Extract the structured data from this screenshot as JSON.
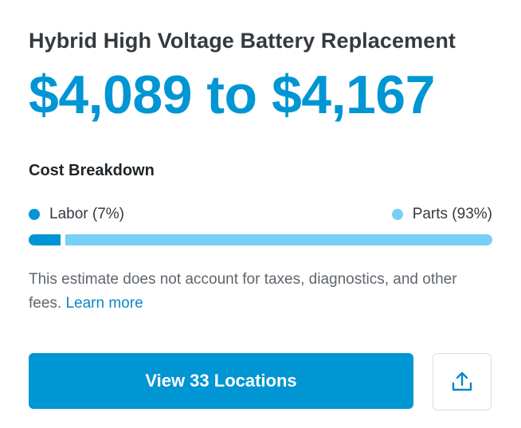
{
  "title": "Hybrid High Voltage Battery Replacement",
  "price_range": "$4,089 to $4,167",
  "breakdown": {
    "heading": "Cost Breakdown",
    "labor": {
      "label": "Labor (7%)",
      "percent": 7,
      "color": "#0095d3"
    },
    "parts": {
      "label": "Parts (93%)",
      "percent": 93,
      "color": "#78d0f6"
    }
  },
  "disclaimer": {
    "text": "This estimate does not account for taxes, diagnostics, and other fees. ",
    "link": "Learn more"
  },
  "actions": {
    "primary_label": "View 33 Locations",
    "share_icon": "share-upload-icon"
  }
}
